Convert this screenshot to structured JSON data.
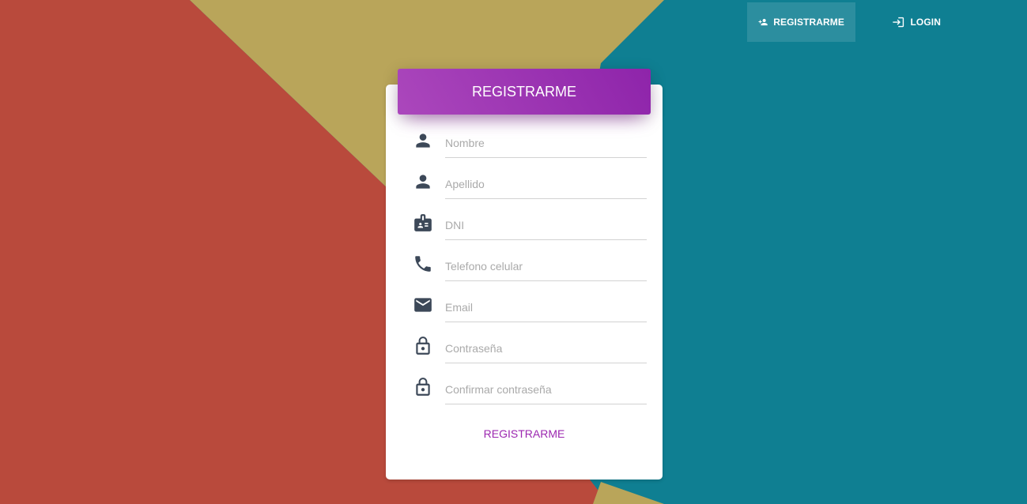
{
  "colors": {
    "accent": "#9c27b0",
    "header_gradient_start": "#ab47bc",
    "header_gradient_end": "#8e24aa",
    "bg_red": "#b94a3c",
    "bg_yellow": "#b9a55a",
    "bg_teal": "#0f7f92",
    "icon": "#3c4858"
  },
  "nav": {
    "register_label": "REGISTRARME",
    "register_icon": "person-add-icon",
    "login_label": "LOGIN",
    "login_icon": "login-icon"
  },
  "card": {
    "title": "REGISTRARME",
    "fields": [
      {
        "icon": "person-icon",
        "placeholder": "Nombre",
        "value": ""
      },
      {
        "icon": "person-icon",
        "placeholder": "Apellido",
        "value": ""
      },
      {
        "icon": "badge-icon",
        "placeholder": "DNI",
        "value": ""
      },
      {
        "icon": "phone-icon",
        "placeholder": "Telefono celular",
        "value": ""
      },
      {
        "icon": "email-icon",
        "placeholder": "Email",
        "value": ""
      },
      {
        "icon": "lock-icon",
        "placeholder": "Contraseña",
        "value": ""
      },
      {
        "icon": "lock-icon",
        "placeholder": "Confirmar contraseña",
        "value": ""
      }
    ],
    "submit_label": "REGISTRARME"
  }
}
